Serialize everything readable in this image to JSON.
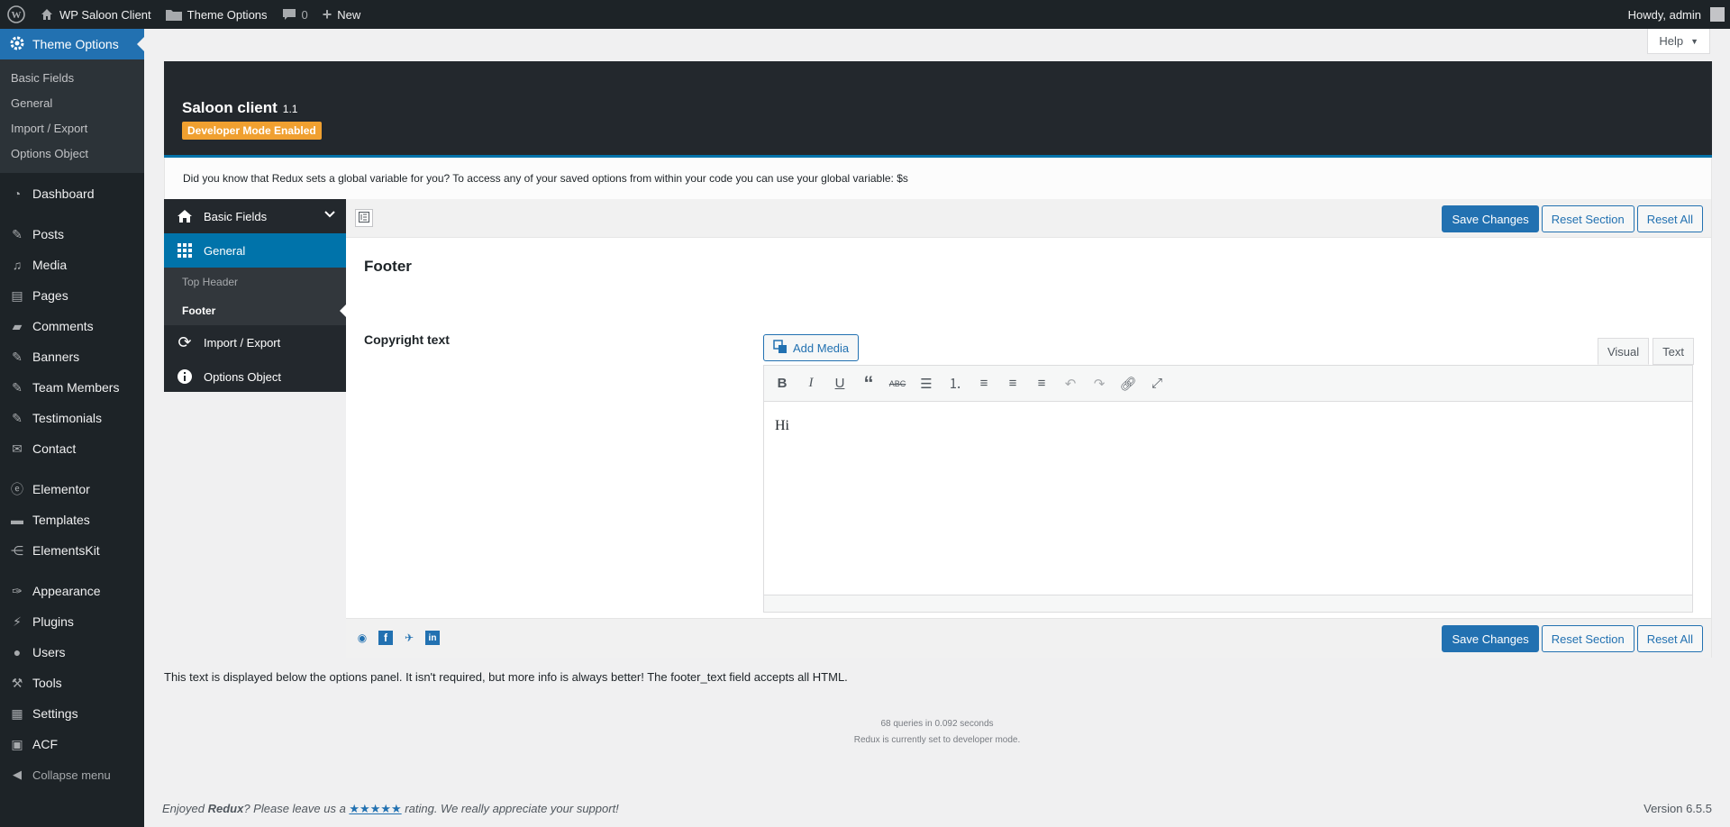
{
  "adminbar": {
    "site_name": "WP Saloon Client",
    "theme_options": "Theme Options",
    "comments_count": "0",
    "new_label": "New",
    "howdy": "Howdy, admin"
  },
  "menu": {
    "current": "Theme Options",
    "submenu": [
      "Basic Fields",
      "General",
      "Import / Export",
      "Options Object"
    ],
    "items": [
      {
        "label": "Dashboard",
        "icon": "dashboard-icon"
      },
      {
        "label": "Posts",
        "icon": "pin-icon"
      },
      {
        "label": "Media",
        "icon": "media-icon"
      },
      {
        "label": "Pages",
        "icon": "pages-icon"
      },
      {
        "label": "Comments",
        "icon": "comment-icon"
      },
      {
        "label": "Banners",
        "icon": "pin-icon"
      },
      {
        "label": "Team Members",
        "icon": "pin-icon"
      },
      {
        "label": "Testimonials",
        "icon": "pin-icon"
      },
      {
        "label": "Contact",
        "icon": "mail-icon"
      },
      {
        "label": "Elementor",
        "icon": "elementor-icon"
      },
      {
        "label": "Templates",
        "icon": "folder-icon"
      },
      {
        "label": "ElementsKit",
        "icon": "elementskit-icon"
      },
      {
        "label": "Appearance",
        "icon": "brush-icon"
      },
      {
        "label": "Plugins",
        "icon": "plugin-icon"
      },
      {
        "label": "Users",
        "icon": "user-icon"
      },
      {
        "label": "Tools",
        "icon": "wrench-icon"
      },
      {
        "label": "Settings",
        "icon": "settings-icon"
      },
      {
        "label": "ACF",
        "icon": "acf-icon"
      }
    ],
    "collapse": "Collapse menu"
  },
  "help": "Help",
  "redux": {
    "title": "Saloon client",
    "version": "1.1",
    "badge": "Developer Mode Enabled",
    "intro": "Did you know that Redux sets a global variable for you? To access any of your saved options from within your code you can use your global variable: $s",
    "nav": {
      "basic_fields": "Basic Fields",
      "general": "General",
      "top_header": "Top Header",
      "footer": "Footer",
      "import_export": "Import / Export",
      "options_object": "Options Object"
    },
    "buttons": {
      "save": "Save Changes",
      "reset_section": "Reset Section",
      "reset_all": "Reset All"
    },
    "section_title": "Footer",
    "field_label": "Copyright text",
    "add_media": "Add Media",
    "editor_tabs": {
      "visual": "Visual",
      "text": "Text"
    },
    "editor_content": "Hi",
    "footer_note": "This text is displayed below the options panel. It isn't required, but more info is always better! The footer_text field accepts all HTML.",
    "queries": "68 queries in 0.092 seconds",
    "dev_mode": "Redux is currently set to developer mode."
  },
  "footer": {
    "enjoyed": "Enjoyed ",
    "redux": "Redux",
    "leave": "? Please leave us a ",
    "stars": "★★★★★",
    "rating": " rating. We really appreciate your support!",
    "version": "Version 6.5.5"
  }
}
